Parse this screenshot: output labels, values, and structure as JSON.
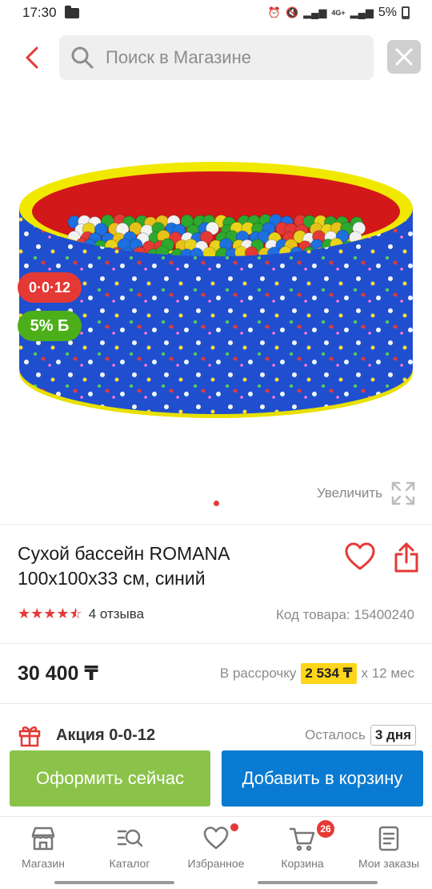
{
  "status_bar": {
    "time": "17:30",
    "battery": "5%",
    "network": "4G+"
  },
  "search": {
    "placeholder": "Поиск в Магазине"
  },
  "badges": {
    "installment": "0·0·12",
    "bonus": "5% Б"
  },
  "gallery": {
    "zoom_label": "Увеличить"
  },
  "product": {
    "title": "Сухой бассейн ROMANA 100х100х33 см, синий",
    "rating": 4.5,
    "reviews": "4 отзыва",
    "sku": "Код товара: 15400240",
    "price": "30 400 ₸",
    "installment_label": "В рассрочку",
    "installment_amount": "2 534 ₸",
    "installment_term": "х 12 мес"
  },
  "promo": {
    "label": "Акция 0-0-12",
    "remaining_label": "Осталось",
    "remaining_value": "3 дня"
  },
  "actions": {
    "buy_now": "Оформить сейчас",
    "add_to_cart": "Добавить в корзину"
  },
  "tabbar": {
    "items": [
      {
        "label": "Магазин",
        "icon": "store-icon"
      },
      {
        "label": "Каталог",
        "icon": "catalog-search-icon"
      },
      {
        "label": "Избранное",
        "icon": "heart-icon"
      },
      {
        "label": "Корзина",
        "icon": "cart-icon",
        "badge": "26"
      },
      {
        "label": "Мои заказы",
        "icon": "orders-icon"
      }
    ]
  },
  "colors": {
    "accent_red": "#e53935",
    "buy_now_green": "#8bc34a",
    "cart_blue": "#0a7bd2",
    "installment_yellow": "#ffd51a"
  }
}
